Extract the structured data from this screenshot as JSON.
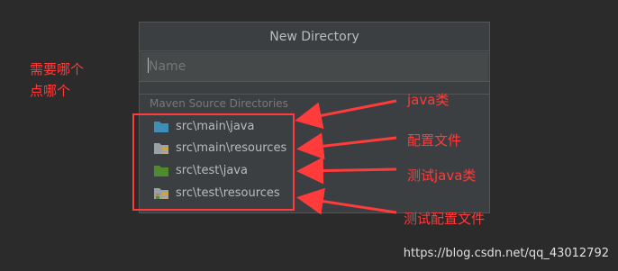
{
  "dialog": {
    "title": "New Directory",
    "name_placeholder": "Name",
    "name_value": "",
    "section_label": "Maven Source Directories",
    "items": [
      {
        "label": "src\\main\\java",
        "icon": "source-folder-icon"
      },
      {
        "label": "src\\main\\resources",
        "icon": "resources-folder-icon"
      },
      {
        "label": "src\\test\\java",
        "icon": "test-source-folder-icon"
      },
      {
        "label": "src\\test\\resources",
        "icon": "test-resources-folder-icon"
      }
    ]
  },
  "annotations": {
    "left_note": [
      "需要哪个",
      "点哪个"
    ],
    "notes": [
      "java类",
      "配置文件",
      "测试java类",
      "测试配置文件"
    ],
    "color": "#ff3b3b"
  },
  "watermark": "https://blog.csdn.net/qq_43012792"
}
